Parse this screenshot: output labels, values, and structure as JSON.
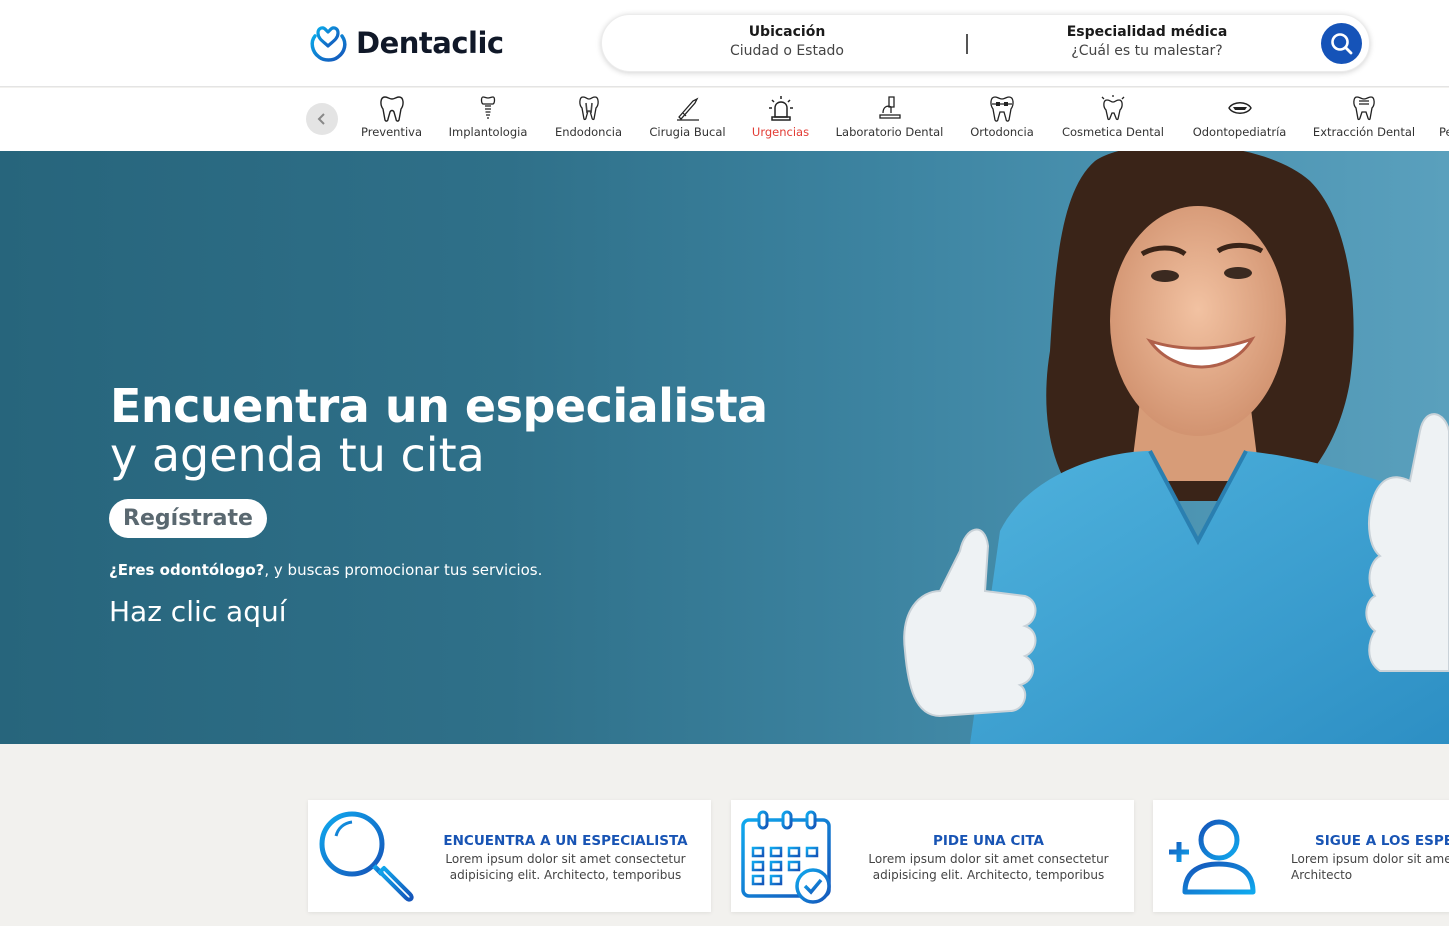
{
  "brand": {
    "name": "Dentaclic",
    "logo_icon": "tooth-heart-icon",
    "accent": "#1553b8"
  },
  "search": {
    "location_label": "Ubicación",
    "location_placeholder": "Ciudad o Estado",
    "specialty_label": "Especialidad médica",
    "specialty_placeholder": "¿Cuál es tu malestar?",
    "button_icon": "search-icon"
  },
  "categories": [
    {
      "label": "Preventiva",
      "icon": "tooth-icon"
    },
    {
      "label": "Implantologia",
      "icon": "implant-icon"
    },
    {
      "label": "Endodoncia",
      "icon": "root-canal-icon"
    },
    {
      "label": "Cirugia Bucal",
      "icon": "scalpel-icon"
    },
    {
      "label": "Urgencias",
      "icon": "siren-icon",
      "active": true,
      "color": "#e23c35"
    },
    {
      "label": "Laboratorio Dental",
      "icon": "microscope-icon"
    },
    {
      "label": "Ortodoncia",
      "icon": "braces-icon"
    },
    {
      "label": "Cosmetica Dental",
      "icon": "sparkle-tooth-icon"
    },
    {
      "label": "Odontopediatría",
      "icon": "kid-mouth-icon"
    },
    {
      "label": "Extracción Dental",
      "icon": "extraction-icon"
    },
    {
      "label": "Pe",
      "icon": ""
    }
  ],
  "hero": {
    "title_line1": "Encuentra un especialista",
    "title_line2": "y agenda tu cita",
    "register_button": "Regístrate",
    "dentist_bold": "¿Eres odontólogo?",
    "dentist_text": ", y buscas promocionar tus servicios.",
    "link": "Haz clic aquí"
  },
  "cards": [
    {
      "title": "ENCUENTRA A UN ESPECIALISTA",
      "text": "Lorem ipsum dolor sit amet consectetur adipisicing elit. Architecto, temporibus",
      "icon": "magnifier-icon"
    },
    {
      "title": "PIDE UNA CITA",
      "text": "Lorem ipsum dolor sit amet consectetur adipisicing elit. Architecto, temporibus",
      "icon": "calendar-check-icon"
    },
    {
      "title": "SIGUE A LOS ESPECI",
      "text": "Lorem ipsum dolor sit ame adipisicing elit. Architecto",
      "icon": "add-user-icon"
    }
  ]
}
